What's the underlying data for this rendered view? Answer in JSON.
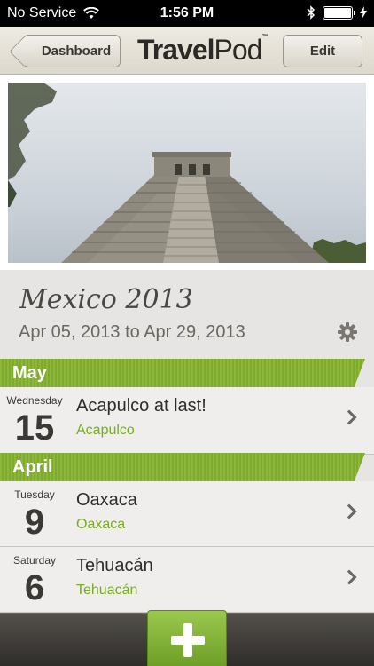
{
  "status_bar": {
    "carrier": "No Service",
    "time": "1:56 PM"
  },
  "nav": {
    "back_label": "Dashboard",
    "title_bold": "Travel",
    "title_regular": "Pod",
    "title_mark": "™",
    "edit_label": "Edit"
  },
  "trip": {
    "title": "Mexico 2013",
    "dates": "Apr 05, 2013 to Apr 29, 2013"
  },
  "sections": [
    {
      "month": "May",
      "entries": [
        {
          "weekday": "Wednesday",
          "day": "15",
          "title": "Acapulco at last!",
          "location": "Acapulco"
        }
      ]
    },
    {
      "month": "April",
      "entries": [
        {
          "weekday": "Tuesday",
          "day": "9",
          "title": "Oaxaca",
          "location": "Oaxaca"
        },
        {
          "weekday": "Saturday",
          "day": "6",
          "title": "Tehuacán",
          "location": "Tehuacán"
        }
      ]
    }
  ],
  "colors": {
    "accent_green": "#7eab2d",
    "location_green": "#78ad1f",
    "nav_bg": "#e6e2d8"
  },
  "icons": {
    "wifi": "wifi-icon",
    "bluetooth": "bluetooth-icon",
    "battery": "battery-icon",
    "settings": "gear-icon",
    "add": "plus-icon",
    "row_disclosure": "chevron-right-icon"
  }
}
